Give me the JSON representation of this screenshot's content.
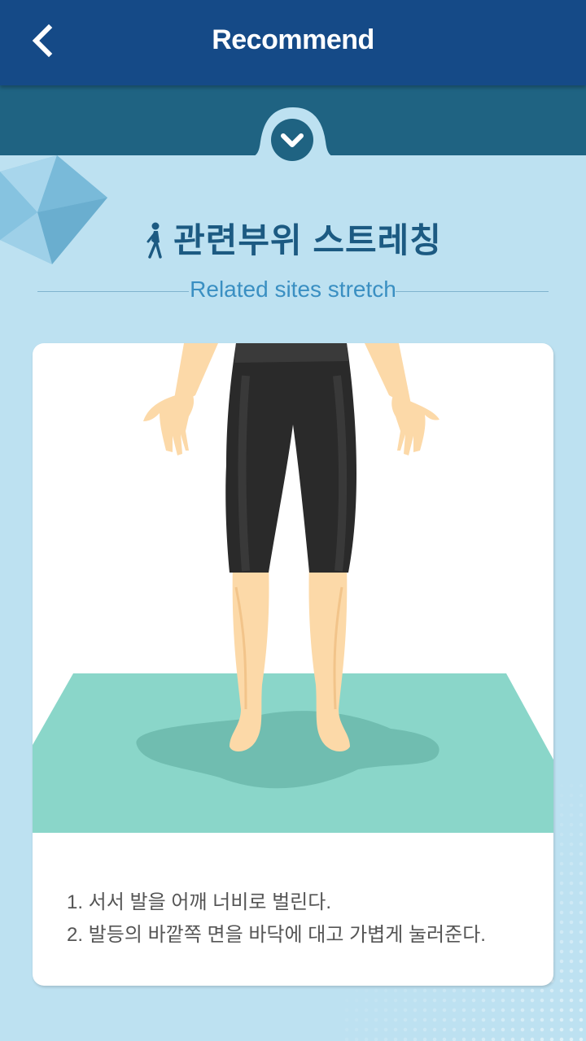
{
  "header": {
    "title": "Recommend"
  },
  "section": {
    "title_ko": "관련부위 스트레칭",
    "subtitle_en": "Related sites stretch"
  },
  "card": {
    "instructions": [
      "1. 서서 발을 어깨 너비로 벌린다.",
      "2. 발등의 바깥쪽 면을 바닥에 대고 가볍게 눌러준다."
    ]
  },
  "icons": {
    "back": "chevron-left-icon",
    "collapse": "chevron-down-icon",
    "section": "stretching-person-icon"
  },
  "colors": {
    "header": "#154a87",
    "band": "#1f6382",
    "background": "#bde1f1",
    "accent_text": "#1c5a82",
    "subtitle_text": "#3a8fc2",
    "mat": "#8ad6c9"
  }
}
